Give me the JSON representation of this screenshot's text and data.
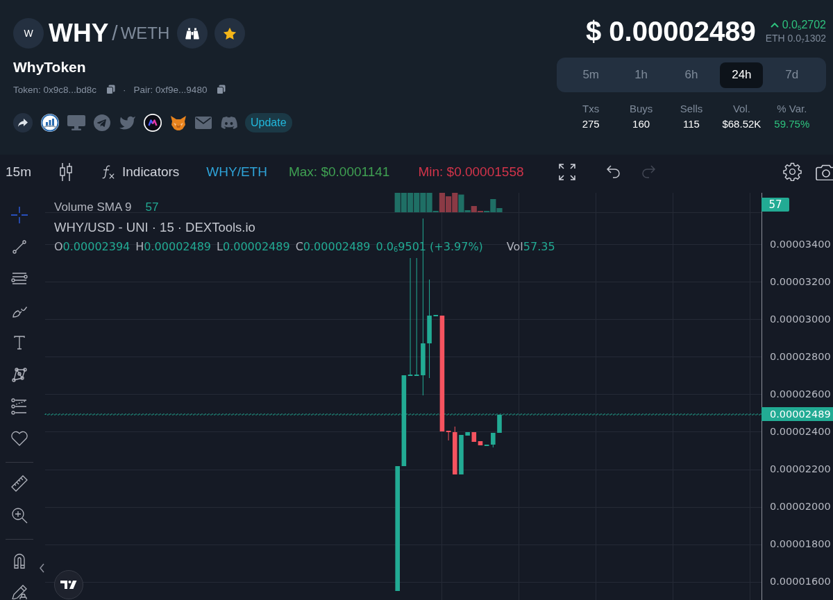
{
  "pair": {
    "avatar": "W",
    "base": "WHY",
    "separator": "/",
    "quote": "WETH"
  },
  "token_name": "WhyToken",
  "addresses": [
    "Token: 0x9c8...bd8c",
    "Pair: 0xf9e...9480"
  ],
  "address_separator": "·",
  "update_button": "Update",
  "price": {
    "usd": "$ 0.00002489",
    "change": "0.0$_{5}$2702",
    "eth": "ETH 0.0$_{7}$1302"
  },
  "timeframes": [
    {
      "label": "5m",
      "selected": false
    },
    {
      "label": "1h",
      "selected": false
    },
    {
      "label": "6h",
      "selected": false
    },
    {
      "label": "24h",
      "selected": true
    },
    {
      "label": "7d",
      "selected": false
    }
  ],
  "stats": [
    {
      "label": "Txs",
      "value": "275",
      "kind": "plain"
    },
    {
      "label": "Buys",
      "value": "160",
      "kind": "plain"
    },
    {
      "label": "Sells",
      "value": "115",
      "kind": "plain"
    },
    {
      "label": "Vol.",
      "value": "$68.52K",
      "kind": "plain"
    },
    {
      "label": "% Var.",
      "value": "59.75%",
      "kind": "gain"
    }
  ],
  "chart_toolbar": {
    "interval": "15m",
    "indicators": "Indicators",
    "symbol": "WHY/ETH",
    "max": "Max: $0.0001141",
    "min": "Min: $0.00001558",
    "history": [
      {
        "kind": "undo",
        "disabled": false
      },
      {
        "kind": "redo",
        "disabled": true
      }
    ]
  },
  "tool_groups": [
    {
      "tools": [
        {
          "kind": "crosshair",
          "selected": true
        },
        {
          "kind": "trend-line",
          "selected": false
        },
        {
          "kind": "fib",
          "selected": false
        },
        {
          "kind": "brush",
          "selected": false
        },
        {
          "kind": "text",
          "selected": false
        },
        {
          "kind": "pattern",
          "selected": false
        },
        {
          "kind": "forecast",
          "selected": false
        },
        {
          "kind": "favorite",
          "selected": false
        }
      ]
    },
    {
      "tools": [
        {
          "kind": "measure",
          "selected": false
        },
        {
          "kind": "zoom",
          "selected": false
        }
      ]
    },
    {
      "tools": [
        {
          "kind": "magnet",
          "selected": false
        },
        {
          "kind": "lock",
          "selected": false
        }
      ]
    }
  ],
  "legend": {
    "volume_label": "Volume SMA 9",
    "volume_value": "57",
    "title": "WHY/USD - UNI · 15 · DEXTools.io",
    "ohlc": [
      {
        "key": "O",
        "value": "0.00002394"
      },
      {
        "key": "H",
        "value": "0.00002489"
      },
      {
        "key": "L",
        "value": "0.00002489"
      },
      {
        "key": "C",
        "value": "0.00002489"
      }
    ],
    "change": "0.0$_{6}$9501 (+3.97%)",
    "volume_key": "Vol",
    "volume": "57.35"
  },
  "price_axis": {
    "volume_badge": "57",
    "labels": [
      "0.00003400",
      "0.00003200",
      "0.00003000",
      "0.00002800",
      "0.00002600",
      "0.00002400",
      "0.00002200",
      "0.00002000",
      "0.00001800",
      "0.00001600"
    ],
    "last_price": "0.00002489"
  }
}
